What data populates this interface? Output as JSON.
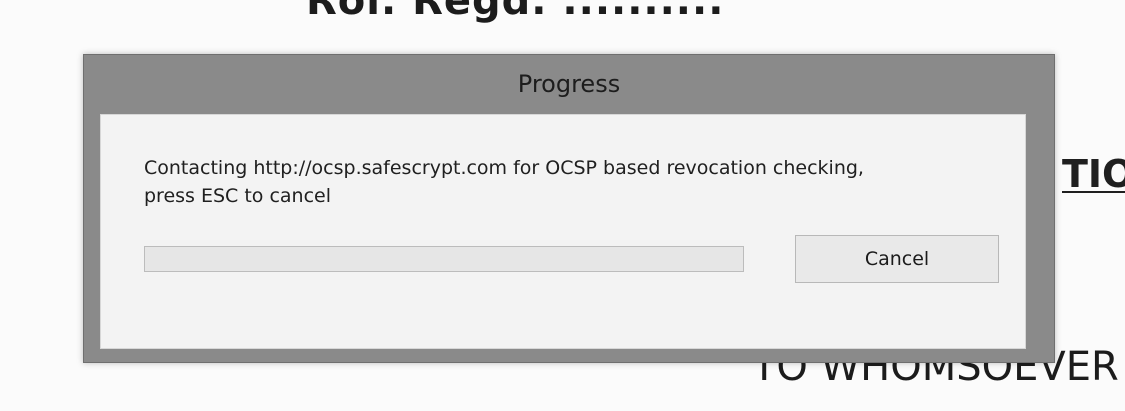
{
  "background": {
    "top_fragment": "Rol. Regd. ..........",
    "right_fragment": "TION",
    "bottom_fragment": "TO WHOMSOEVER"
  },
  "dialog": {
    "title": "Progress",
    "message": "Contacting http://ocsp.safescrypt.com for OCSP based revocation checking,\npress ESC to cancel",
    "progress_percent": 0,
    "cancel_label": "Cancel"
  },
  "colors": {
    "frame": "#8a8a8a",
    "body": "#f3f3f3",
    "progress_track": "#e6e6e6",
    "button": "#e9e9e9"
  }
}
